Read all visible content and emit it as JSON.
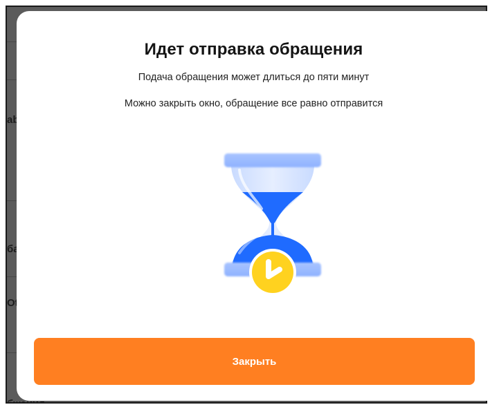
{
  "background": {
    "fragments": [
      "ab",
      "ба",
      "Ot",
      "бжения"
    ]
  },
  "modal": {
    "title": "Идет отправка обращения",
    "subtitle_1": "Подача обращения может длиться до пяти минут",
    "subtitle_2": "Можно закрыть окно, обращение все равно отправится",
    "illustration_icon": "hourglass-clock-icon",
    "close_label": "Закрыть"
  },
  "colors": {
    "accent": "#ff7f21",
    "hourglass_blue": "#1f6bff",
    "hourglass_light": "#b8d0ff",
    "clock_yellow": "#ffd21f"
  }
}
